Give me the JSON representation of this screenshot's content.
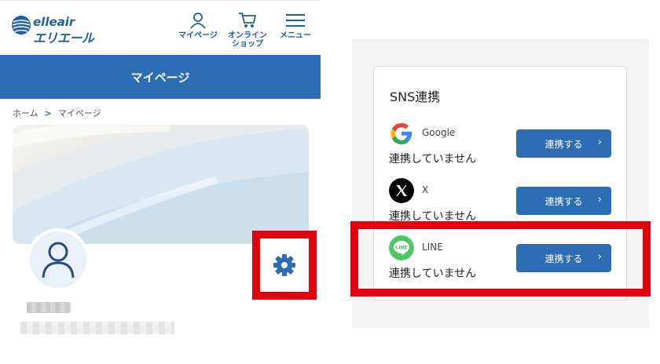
{
  "header": {
    "logo_en": "elleair",
    "logo_ja": "エリエール",
    "nav": [
      {
        "label": "マイページ",
        "icon": "person-icon"
      },
      {
        "label": "オンライン\nショップ",
        "icon": "cart-icon"
      },
      {
        "label": "メニュー",
        "icon": "hamburger-menu-icon"
      }
    ]
  },
  "page_title": "マイページ",
  "breadcrumb": {
    "home": "ホーム",
    "separator": ">",
    "current": "マイページ"
  },
  "sns": {
    "title": "SNS連携",
    "services": [
      {
        "name": "Google",
        "status": "連携していません",
        "button": "連携する",
        "icon": "google-icon"
      },
      {
        "name": "X",
        "status": "連携していません",
        "button": "連携する",
        "icon": "x-icon"
      },
      {
        "name": "LINE",
        "status": "連携していません",
        "button": "連携する",
        "icon": "line-icon"
      }
    ]
  },
  "colors": {
    "brand_blue": "#2c6db6",
    "highlight_red": "#e0010e",
    "line_green": "#4cc764"
  }
}
